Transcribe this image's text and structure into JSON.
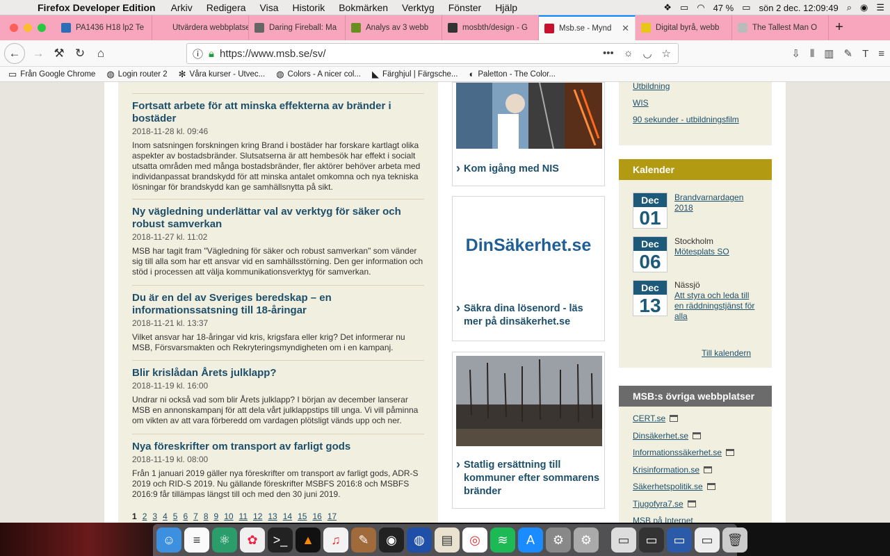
{
  "menubar": {
    "app": "Firefox Developer Edition",
    "items": [
      "Arkiv",
      "Redigera",
      "Visa",
      "Historik",
      "Bokmärken",
      "Verktyg",
      "Fönster",
      "Hjälp"
    ],
    "battery": "47 %",
    "clock": "sön 2 dec.  12:09:49"
  },
  "tabs": [
    {
      "label": "PA1436 H18 lp2 Te",
      "color": "#2a6fb5"
    },
    {
      "label": "Utvärdera webbplatser",
      "color": "#f8a6bd"
    },
    {
      "label": "Daring Fireball: Ma",
      "color": "#666666"
    },
    {
      "label": "Analys av 3 webb",
      "color": "#6b8e23"
    },
    {
      "label": "mosbth/design - G",
      "color": "#333333"
    },
    {
      "label": "Msb.se - Mynd",
      "color": "#c8102e",
      "active": true
    },
    {
      "label": "Digital byrå, webb",
      "color": "#e6c619"
    },
    {
      "label": "The Tallest Man O",
      "color": "#bbbbbb"
    }
  ],
  "nav": {
    "url": "https://www.msb.se/sv/"
  },
  "bookmarks": [
    {
      "label": "Från Google Chrome",
      "icon": "folder-icon"
    },
    {
      "label": "Login router 2",
      "icon": "globe-icon"
    },
    {
      "label": "Våra kurser - Utvec...",
      "icon": "gear-icon"
    },
    {
      "label": "Colors - A nicer col...",
      "icon": "globe-icon"
    },
    {
      "label": "Färghjul | Färgsche...",
      "icon": "adobe-icon"
    },
    {
      "label": "Paletton - The Color...",
      "icon": "palette-icon"
    }
  ],
  "news": [
    {
      "title": "Fortsatt arbete för att minska effekterna av bränder i bostäder",
      "date": "2018-11-28 kl. 09:46",
      "text": "Inom satsningen forskningen kring Brand i bostäder har forskare kartlagt olika aspekter av bostadsbränder. Slutsatserna är att hembesök har effekt i socialt utsatta områden med många bostadsbränder, fler aktörer behöver arbeta med individanpassat brandskydd för att minska antalet omkomna och nya tekniska lösningar för brandskydd kan ge samhällsnytta på sikt."
    },
    {
      "title": "Ny vägledning underlättar val av verktyg för säker och robust samverkan",
      "date": "2018-11-27 kl. 11:02",
      "text": "MSB har tagit fram \"Vägledning för säker och robust samverkan\" som vänder sig till alla som har ett ansvar vid en samhällsstörning. Den ger information och stöd i processen att välja kommunikationsverktyg för samverkan."
    },
    {
      "title": "Du är en del av Sveriges beredskap – en informationssatsning till 18-åringar",
      "date": "2018-11-21 kl. 13:37",
      "text": "Vilket ansvar har 18-åringar vid kris, krigsfara eller krig? Det informerar nu MSB, Försvarsmakten och Rekryteringsmyndigheten om i en kampanj."
    },
    {
      "title": "Blir krislådan Årets julklapp?",
      "date": "2018-11-19 kl. 16:00",
      "text": "Undrar ni också vad som blir Årets julklapp? I början av december lanserar MSB en annonskampanj för att dela vårt julklappstips till unga. Vi vill påminna om vikten av att vara förberedd om vardagen plötsligt vänds upp och ner."
    },
    {
      "title": "Nya föreskrifter om transport av farligt gods",
      "date": "2018-11-19 kl. 08:00",
      "text": "Från 1 januari 2019 gäller nya föreskrifter om transport av farligt gods, ADR-S 2019 och RID-S 2019. Nu gällande föreskrifter MSBFS 2016:8 och MSBFS 2016:9 får tillämpas längst till och med den 30 juni 2019."
    }
  ],
  "pager": [
    "1",
    "2",
    "3",
    "4",
    "5",
    "6",
    "7",
    "8",
    "9",
    "10",
    "11",
    "12",
    "13",
    "14",
    "15",
    "16",
    "17"
  ],
  "cards": {
    "nis": "Kom igång med NIS",
    "dinsak_logo": "DinSäkerhet.se",
    "dinsak": "Säkra dina lösenord - läs mer på dinsäkerhet.se",
    "fire": "Statlig ersättning till kommuner efter sommarens bränder"
  },
  "training": {
    "links": [
      "Utbildning",
      "WIS",
      "90 sekunder - utbildningsfilm"
    ]
  },
  "calendar": {
    "title": "Kalender",
    "events": [
      {
        "month": "Dec",
        "day": "01",
        "place": "",
        "link": "Brandvarnardagen 2018"
      },
      {
        "month": "Dec",
        "day": "06",
        "place": "Stockholm",
        "link": "Mötesplats SO"
      },
      {
        "month": "Dec",
        "day": "13",
        "place": "Nässjö",
        "link": "Att styra och leda till en räddningstjänst för alla"
      }
    ],
    "more": "Till kalendern"
  },
  "sites": {
    "title": "MSB:s övriga webbplatser",
    "links": [
      "CERT.se",
      "Dinsäkerhet.se",
      "Informationssäkerhet.se",
      "Krisinformation.se",
      "Säkerhetspolitik.se",
      "Tjugofyra7.se",
      "MSB på Internet"
    ]
  },
  "colors": {
    "accent_blue": "#1d4f6b",
    "calendar_head": "#b29a12",
    "sites_head": "#6b6b6b"
  }
}
